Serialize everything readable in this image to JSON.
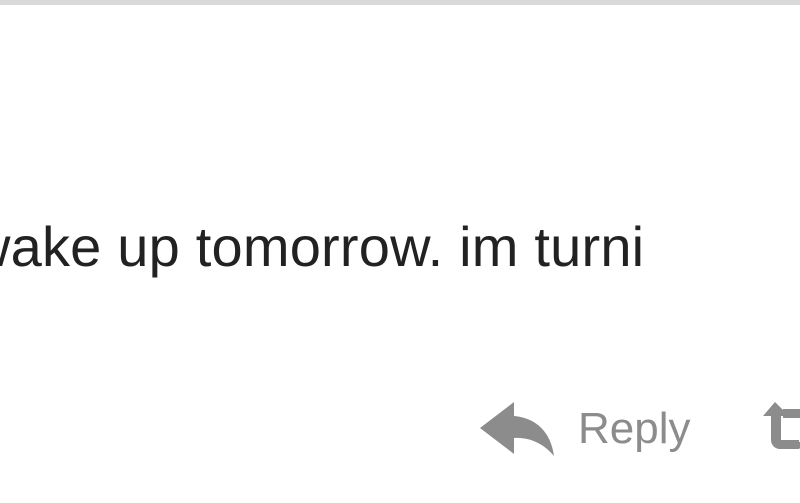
{
  "tweet": {
    "text": "wake up tomorrow. im turni"
  },
  "actions": {
    "reply_label": "Reply",
    "reply_icon": "reply-arrow-icon",
    "next_icon": "retweet-icon"
  },
  "colors": {
    "text": "#222222",
    "action": "#8c8c8c",
    "divider": "#d9d9d9"
  }
}
